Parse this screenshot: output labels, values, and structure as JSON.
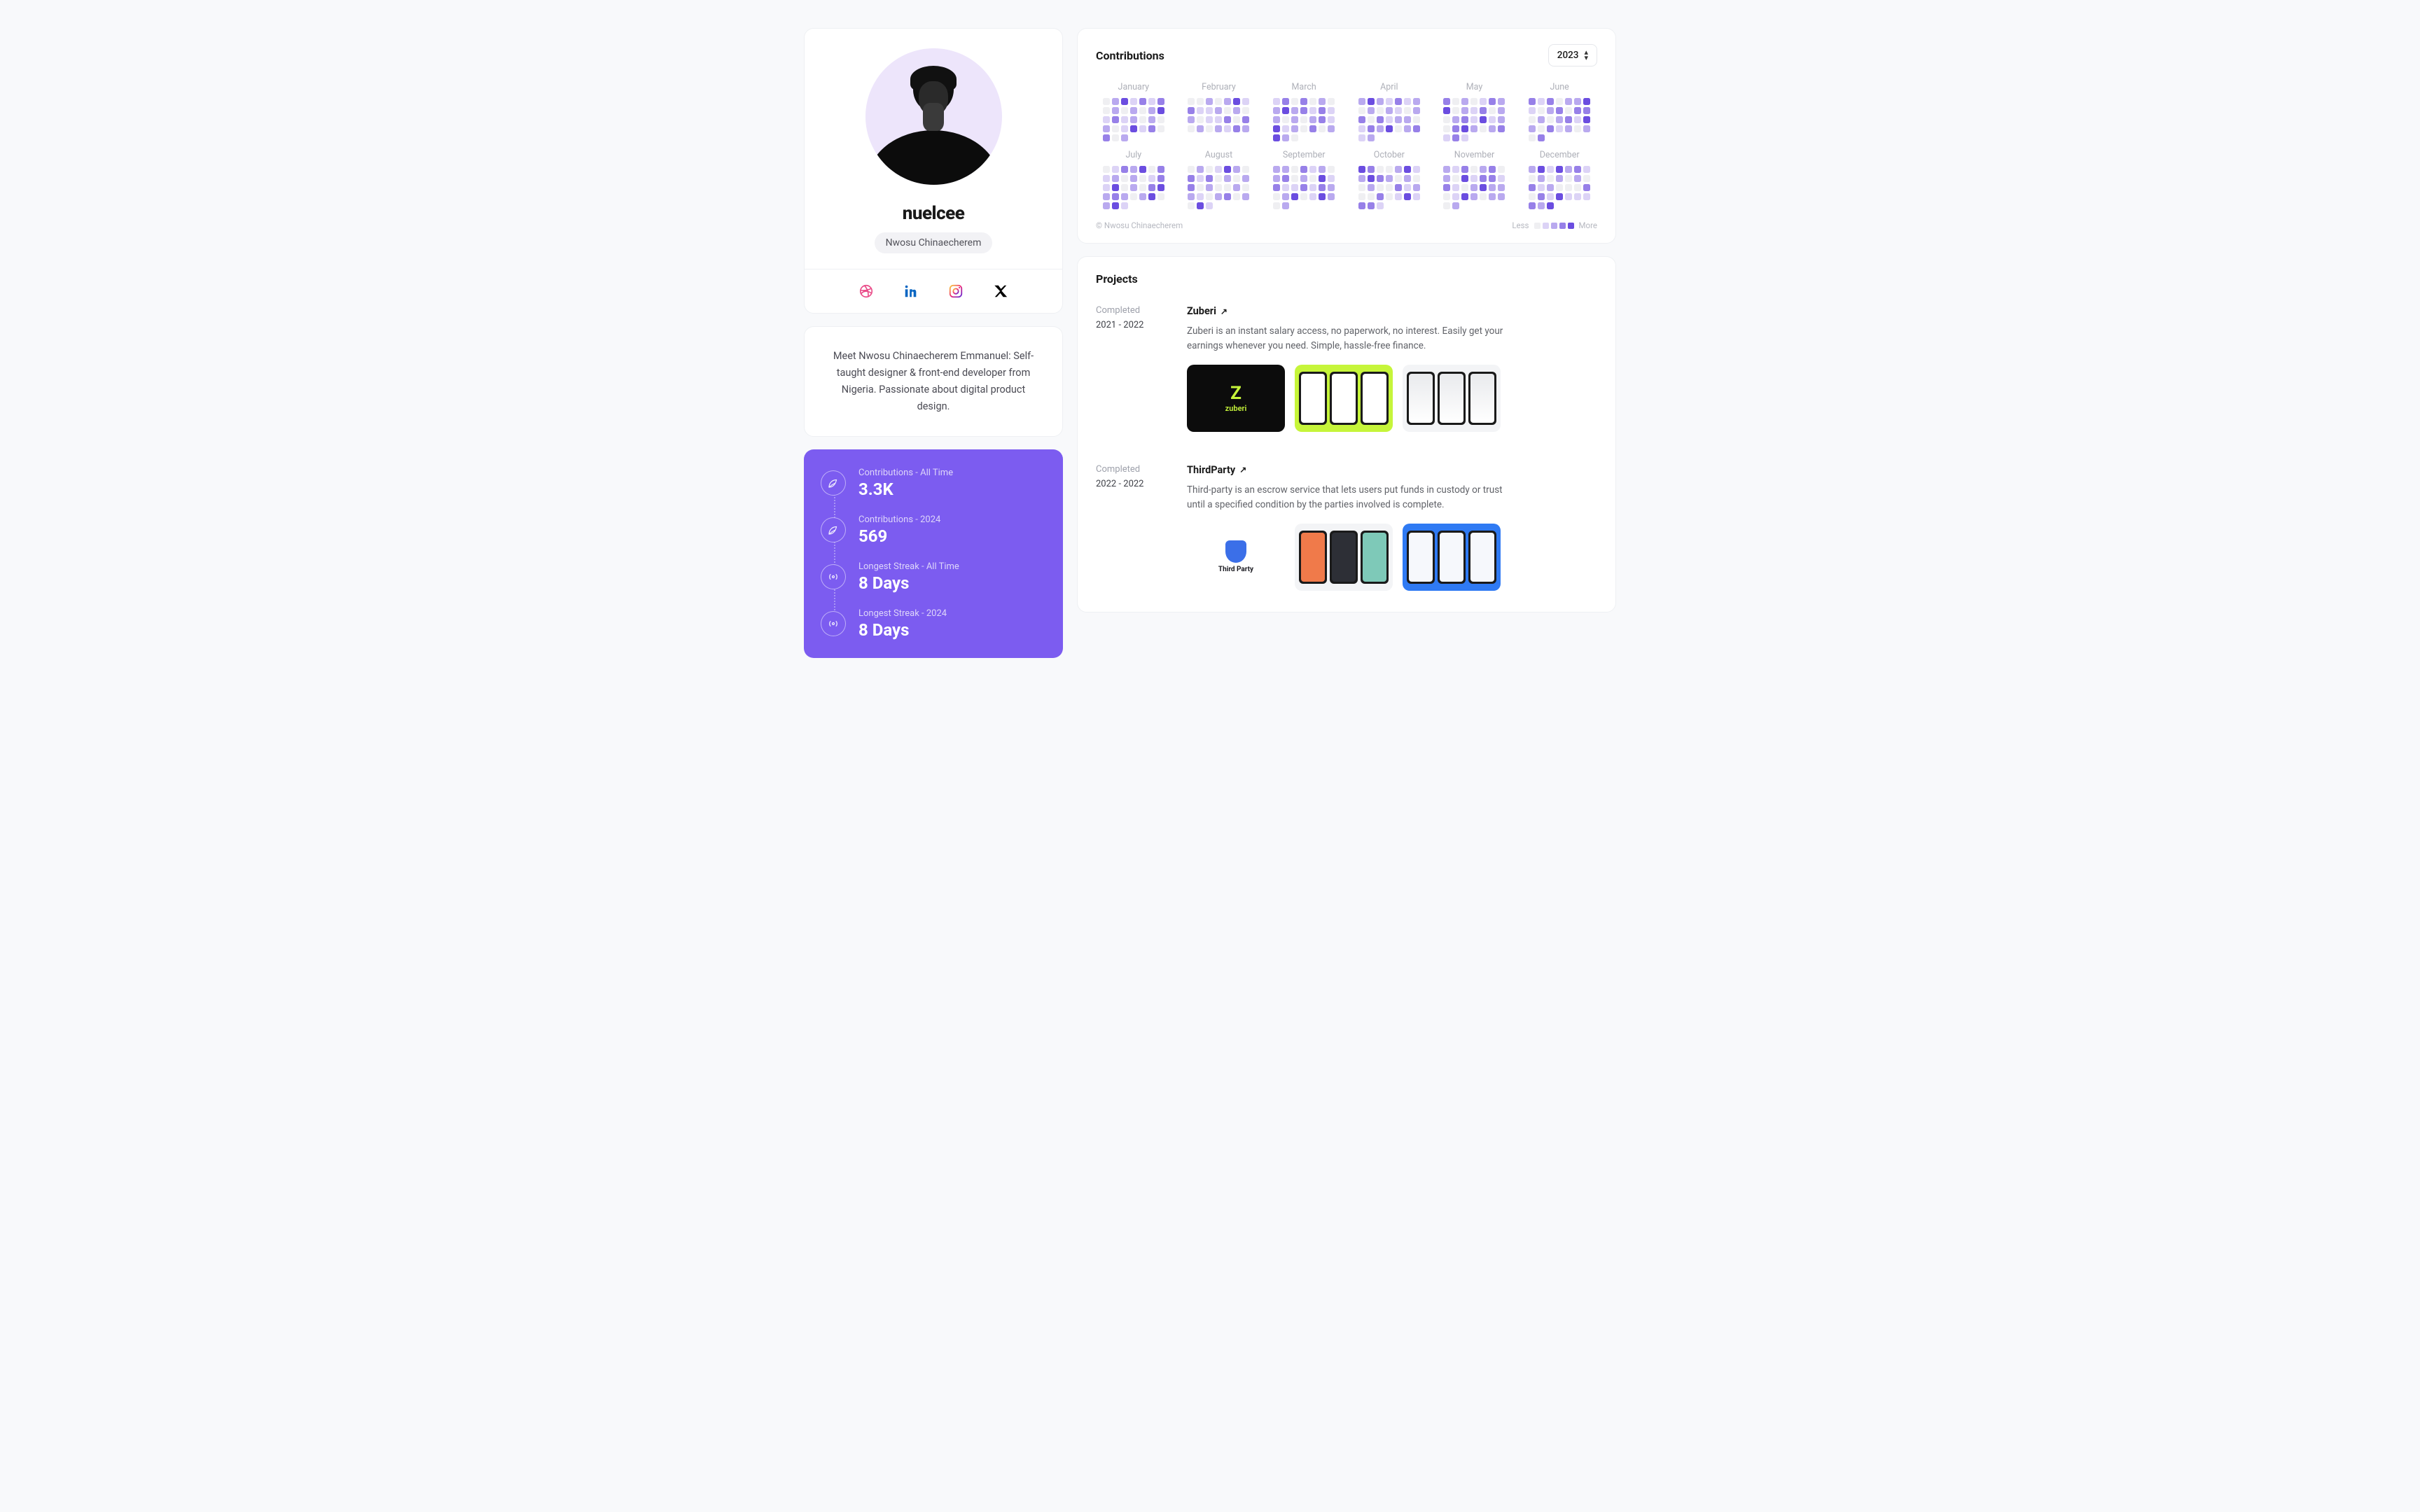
{
  "profile": {
    "username": "nuelcee",
    "fullname": "Nwosu Chinaecherem",
    "bio": "Meet Nwosu Chinaecherem Emmanuel: Self-taught designer & front-end developer from Nigeria. Passionate about digital product design."
  },
  "socials": [
    "dribbble",
    "linkedin",
    "instagram",
    "x"
  ],
  "stats": [
    {
      "icon": "leaf",
      "label": "Contributions - All Time",
      "value": "3.3K"
    },
    {
      "icon": "leaf",
      "label": "Contributions - 2024",
      "value": "569"
    },
    {
      "icon": "signal",
      "label": "Longest Streak - All Time",
      "value": "8 Days"
    },
    {
      "icon": "signal",
      "label": "Longest Streak - 2024",
      "value": "8 Days"
    }
  ],
  "contributions": {
    "title": "Contributions",
    "year": "2023",
    "months": [
      "January",
      "February",
      "March",
      "April",
      "May",
      "June",
      "July",
      "August",
      "September",
      "October",
      "November",
      "December"
    ],
    "copyright": "© Nwosu Chinaecherem",
    "legend_less": "Less",
    "legend_more": "More"
  },
  "projects": {
    "title": "Projects",
    "items": [
      {
        "status": "Completed",
        "range": "2021 - 2022",
        "name": "Zuberi",
        "desc": "Zuberi is an instant salary access, no paperwork, no interest. Easily get your earnings whenever you need. Simple, hassle-free finance.",
        "brand": "zuberi",
        "thumb_style": "zuberi"
      },
      {
        "status": "Completed",
        "range": "2022 - 2022",
        "name": "ThirdParty",
        "desc": "Third-party is an escrow service that lets users put funds in custody or trust until a specified condition by the parties involved is complete.",
        "brand": "Third Party",
        "thumb_style": "thirdparty"
      }
    ]
  }
}
